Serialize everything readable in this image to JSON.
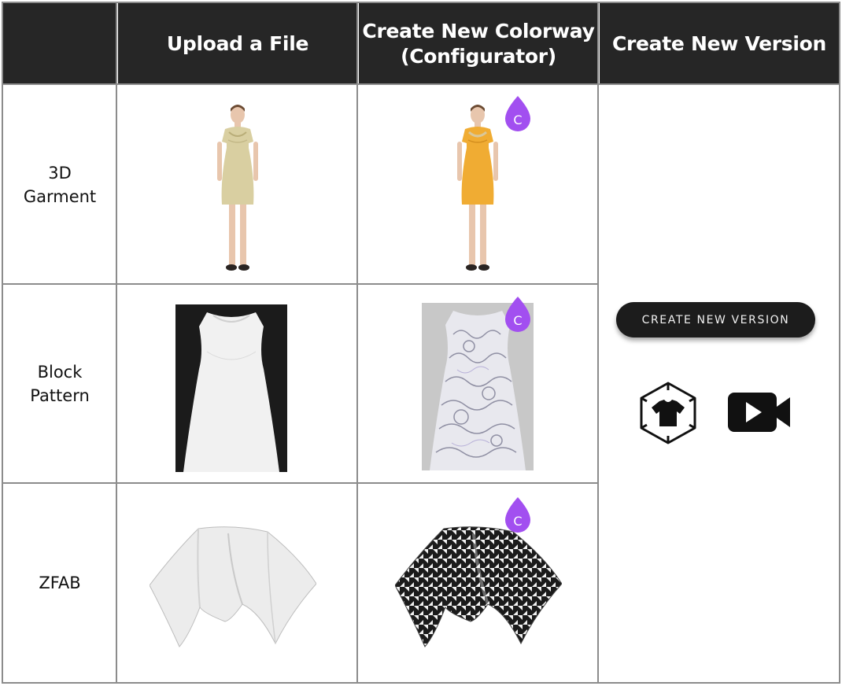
{
  "header": {
    "col1": "Upload a File",
    "col2": "Create New Colorway\n(Configurator)",
    "col3": "Create New Version"
  },
  "rows": [
    {
      "label": "3D\nGarment"
    },
    {
      "label": "Block\nPattern"
    },
    {
      "label": "ZFAB"
    }
  ],
  "create_version_button": {
    "label": "CREATE NEW VERSION"
  },
  "badge": {
    "letter": "C",
    "color": "#a24ff0"
  },
  "icons": [
    "garment-3d-icon",
    "video-camera-icon"
  ],
  "colors": {
    "header_bg": "#262626",
    "grid_line": "#8c8c8c",
    "dress_beige": "#d9cfa1",
    "dress_orange": "#f0ac33"
  }
}
